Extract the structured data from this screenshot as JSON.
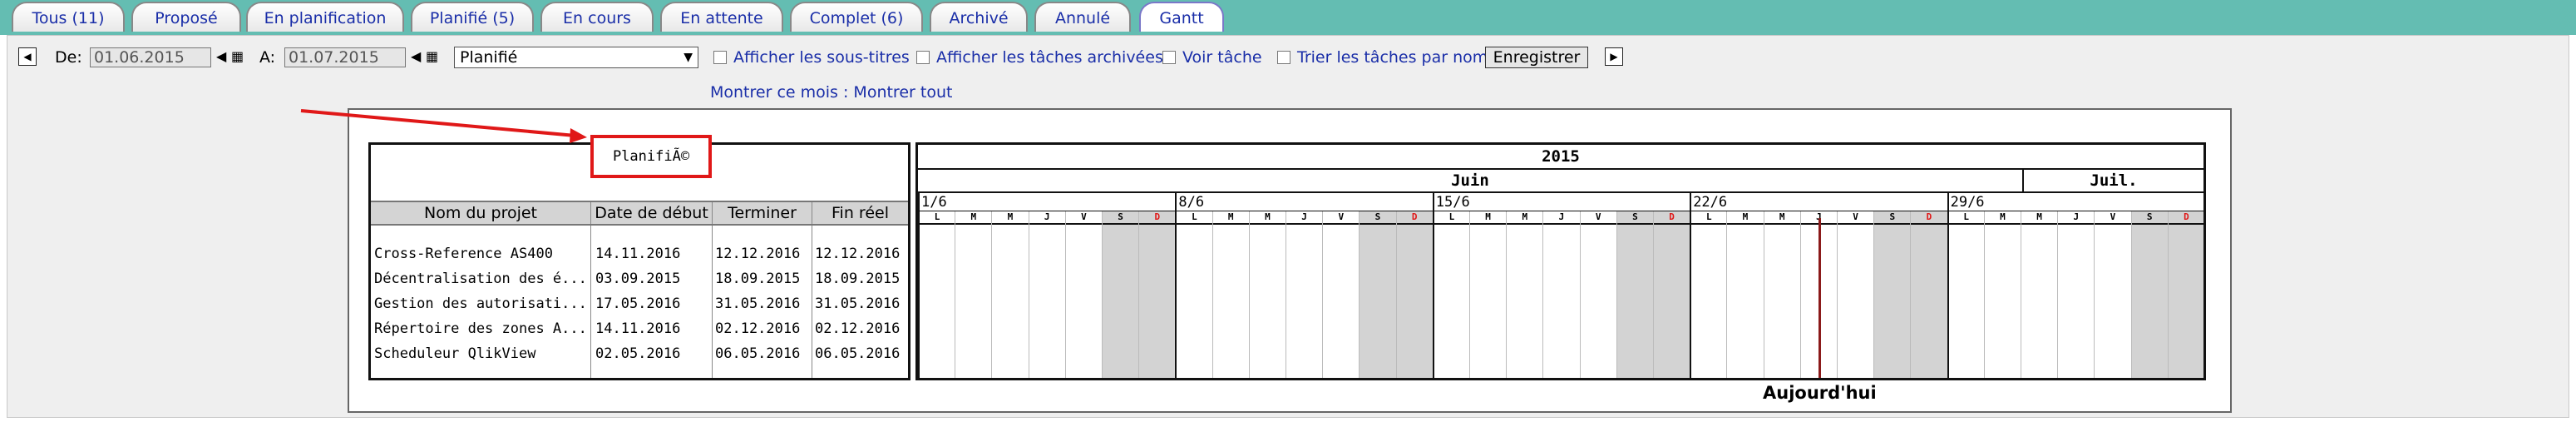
{
  "tabs": [
    {
      "label": "Tous (11)"
    },
    {
      "label": "Proposé"
    },
    {
      "label": "En planification"
    },
    {
      "label": "Planifié (5)"
    },
    {
      "label": "En cours"
    },
    {
      "label": "En attente"
    },
    {
      "label": "Complet (6)"
    },
    {
      "label": "Archivé"
    },
    {
      "label": "Annulé"
    },
    {
      "label": "Gantt",
      "active": true
    }
  ],
  "toolbar": {
    "prev_icon": "triangle-left-icon",
    "from_label": "De:",
    "from_value": "01.06.2015",
    "to_label": "A:",
    "to_value": "01.07.2015",
    "calendar_icon": "calendar-icon",
    "status_select": "Planifié",
    "show_subtitles": "Afficher les sous-titres",
    "show_archived": "Afficher les tâches archivées",
    "view_task": "Voir tâche",
    "sort_by_name": "Trier les tâches par nom",
    "save_label": "Enregistrer",
    "next_icon": "triangle-right-icon"
  },
  "links": {
    "this_month": "Montrer ce mois",
    "separator": " : ",
    "show_all": "Montrer tout"
  },
  "gantt": {
    "section_title": "PlanifiÃ©",
    "columns": [
      "Nom du projet",
      "Date de début",
      "Terminer",
      "Fin réel"
    ],
    "rows": [
      [
        "Cross-Reference AS400",
        "14.11.2016",
        "12.12.2016",
        "12.12.2016"
      ],
      [
        "Décentralisation des é...",
        "03.09.2015",
        "18.09.2015",
        "18.09.2015"
      ],
      [
        "Gestion des autorisati...",
        "17.05.2016",
        "31.05.2016",
        "31.05.2016"
      ],
      [
        "Répertoire des zones A...",
        "14.11.2016",
        "02.12.2016",
        "02.12.2016"
      ],
      [
        "Scheduleur QlikView",
        "02.05.2016",
        "06.05.2016",
        "06.05.2016"
      ]
    ],
    "year": "2015",
    "month_june": "Juin",
    "month_july": "Juil.",
    "weeks": [
      "1/6",
      "8/6",
      "15/6",
      "22/6",
      "29/6"
    ],
    "day_letters": [
      "L",
      "M",
      "M",
      "J",
      "V",
      "S",
      "D"
    ],
    "today_day_index": 24,
    "today_label": "Aujourd'hui",
    "colors": {
      "today_line": "#8b1a1a",
      "weekend": "#d3d3d3",
      "sunday_text": "#e01818",
      "annotation": "#e01818"
    }
  }
}
